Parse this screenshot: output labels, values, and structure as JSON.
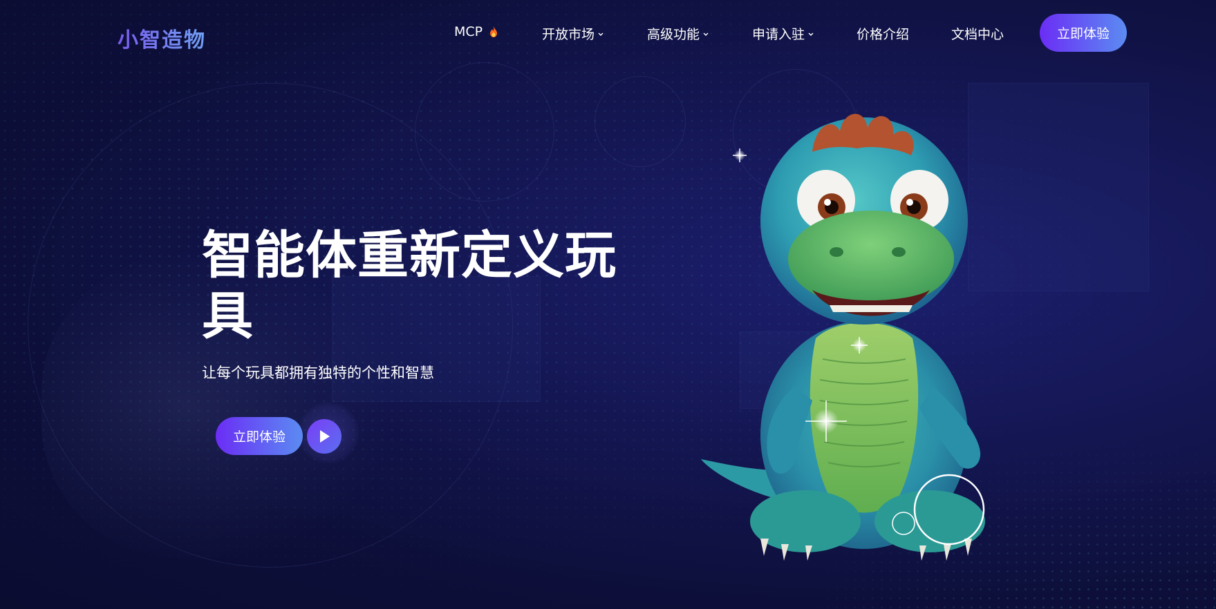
{
  "header": {
    "logo_text": "小智造物",
    "nav": [
      {
        "label": "MCP",
        "icon": "flame-icon",
        "dropdown": false
      },
      {
        "label": "开放市场",
        "dropdown": true
      },
      {
        "label": "高级功能",
        "dropdown": true
      },
      {
        "label": "申请入驻",
        "dropdown": true
      },
      {
        "label": "价格介绍",
        "dropdown": false
      },
      {
        "label": "文档中心",
        "dropdown": false
      }
    ],
    "cta_label": "立即体验"
  },
  "hero": {
    "title": "智能体重新定义玩具",
    "subtitle": "让每个玩具都拥有独特的个性和智慧",
    "cta_label": "立即体验",
    "play_icon": "play-icon"
  },
  "mascot": {
    "icon": "dinosaur-toy-illustration"
  },
  "colors": {
    "background": "#141652",
    "accent_start": "#6b2df5",
    "accent_end": "#5b8cf2",
    "text": "#ffffff"
  }
}
